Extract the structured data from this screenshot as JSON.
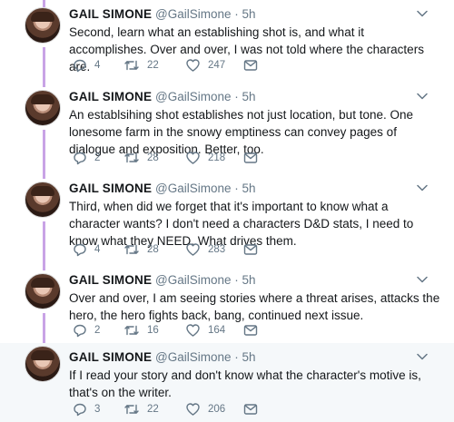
{
  "tweets": [
    {
      "name": "GAIL SIMONE",
      "handle": "@GailSimone",
      "sep": "·",
      "time": "5h",
      "text": "Second, learn what an establishing shot is, and what it accomplishes. Over and over, I was not told where the characters are.",
      "replies": "4",
      "retweets": "22",
      "likes": "247"
    },
    {
      "name": "GAIL SIMONE",
      "handle": "@GailSimone",
      "sep": "·",
      "time": "5h",
      "text": "An establsihing shot establishes not just location, but tone. One lonesome farm in the snowy emptiness can convey pages of dialogue and exposition. Better, too.",
      "replies": "2",
      "retweets": "28",
      "likes": "218"
    },
    {
      "name": "GAIL SIMONE",
      "handle": "@GailSimone",
      "sep": "·",
      "time": "5h",
      "text": "Third, when did we forget that it's important to know what a character wants? I don't need a characters D&D stats, I need to know what they NEED. What drives them.",
      "replies": "4",
      "retweets": "28",
      "likes": "283"
    },
    {
      "name": "GAIL SIMONE",
      "handle": "@GailSimone",
      "sep": "·",
      "time": "5h",
      "text": "Over and over, I am seeing stories where a threat arises, attacks the hero, the hero fights back, bang, continued next issue.",
      "replies": "2",
      "retweets": "16",
      "likes": "164"
    },
    {
      "name": "GAIL SIMONE",
      "handle": "@GailSimone",
      "sep": "·",
      "time": "5h",
      "text": "If I read your story and don't know what the character's motive is, that's on the writer.",
      "replies": "3",
      "retweets": "22",
      "likes": "206"
    }
  ],
  "icons": [
    "reply-icon",
    "retweet-icon",
    "like-icon",
    "message-icon",
    "chevron-down-icon"
  ],
  "colors": {
    "thread_line": "#c9a3e6",
    "icon": "#657786",
    "highlight_bg": "#f5f8fa"
  }
}
